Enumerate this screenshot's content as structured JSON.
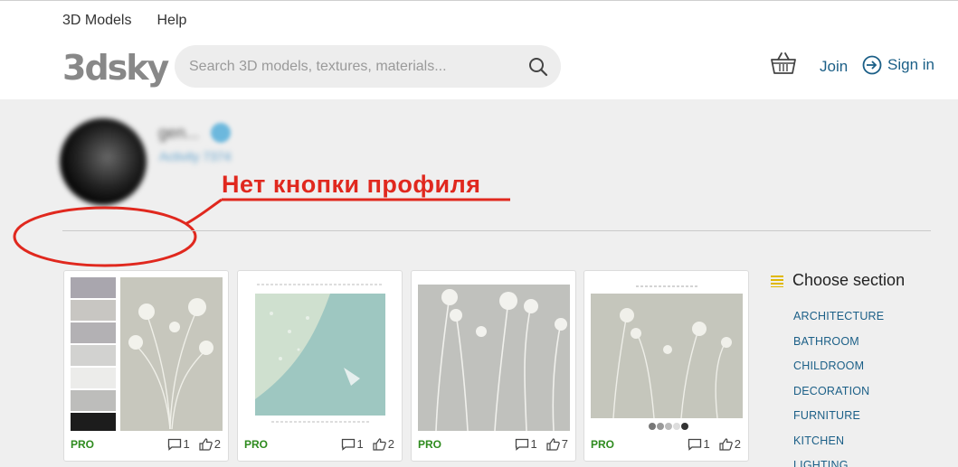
{
  "topnav": [
    "3D Models",
    "Help"
  ],
  "logo": "3dsky",
  "search": {
    "placeholder": "Search 3D models, textures, materials..."
  },
  "header": {
    "join": "Join",
    "signin": "Sign in"
  },
  "profile": {
    "name": "gen...",
    "rating": "Activity 7374"
  },
  "annotation": "Нет кнопки профиля",
  "cards": [
    {
      "badge": "PRO",
      "comments": "1",
      "likes": "2"
    },
    {
      "badge": "PRO",
      "comments": "1",
      "likes": "2"
    },
    {
      "badge": "PRO",
      "comments": "1",
      "likes": "7"
    },
    {
      "badge": "PRO",
      "comments": "1",
      "likes": "2"
    }
  ],
  "sidebar": {
    "title": "Choose section",
    "categories": [
      "ARCHITECTURE",
      "BATHROOM",
      "CHILDROOM",
      "DECORATION",
      "FURNITURE",
      "KITCHEN",
      "LIGHTING"
    ]
  },
  "colors": {
    "link": "#1b5f87",
    "pro": "#2e8b1e",
    "annotation": "#e0281e",
    "menu_icon": "#e0b800"
  }
}
